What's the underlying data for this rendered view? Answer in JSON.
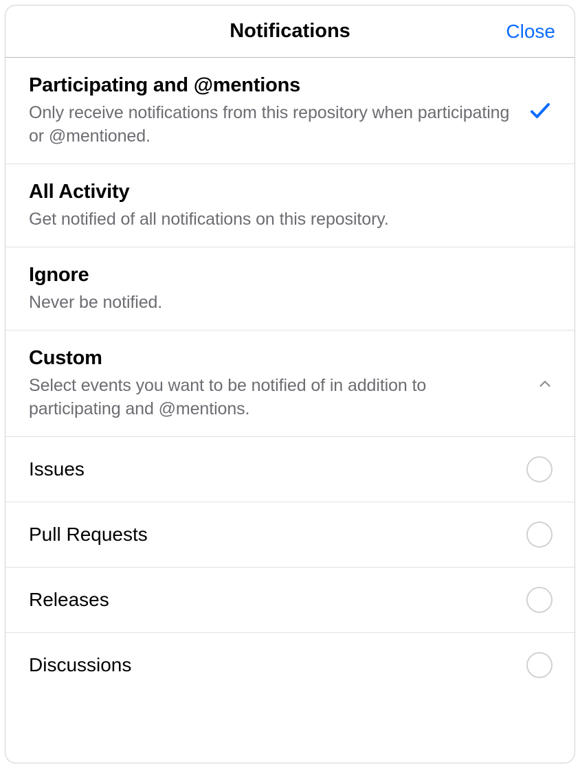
{
  "header": {
    "title": "Notifications",
    "close_label": "Close"
  },
  "options": {
    "participating": {
      "title": "Participating and @mentions",
      "desc": "Only receive notifications from this repository when participating or @mentioned."
    },
    "all": {
      "title": "All Activity",
      "desc": "Get notified of all notifications on this repository."
    },
    "ignore": {
      "title": "Ignore",
      "desc": "Never be notified."
    },
    "custom": {
      "title": "Custom",
      "desc": "Select events you want to be notified of in addition to participating and @mentions."
    }
  },
  "events": {
    "issues": "Issues",
    "pull_requests": "Pull Requests",
    "releases": "Releases",
    "discussions": "Discussions"
  }
}
